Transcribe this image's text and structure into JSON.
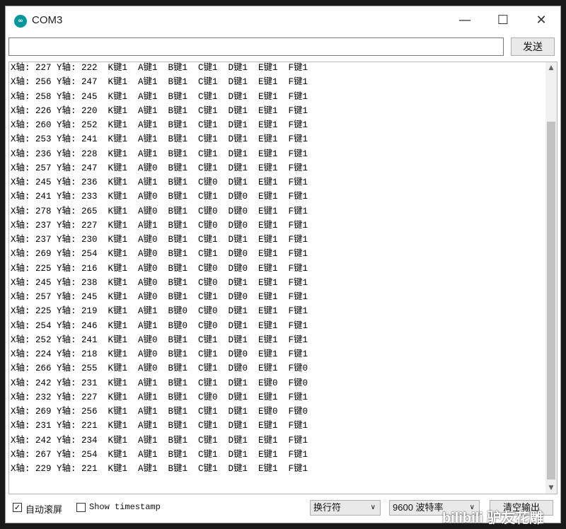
{
  "window": {
    "title": "COM3",
    "icon": "arduino-icon",
    "controls": {
      "minimize": "—",
      "maximize": "☐",
      "close": "✕"
    }
  },
  "send_bar": {
    "input_value": "",
    "send_label": "发送"
  },
  "output_lines": [
    "X轴: 227 Y轴: 222  K键1  A键1  B键1  C键1  D键1  E键1  F键1",
    "X轴: 256 Y轴: 247  K键1  A键1  B键1  C键1  D键1  E键1  F键1",
    "X轴: 258 Y轴: 245  K键1  A键1  B键1  C键1  D键1  E键1  F键1",
    "X轴: 226 Y轴: 220  K键1  A键1  B键1  C键1  D键1  E键1  F键1",
    "X轴: 260 Y轴: 252  K键1  A键1  B键1  C键1  D键1  E键1  F键1",
    "X轴: 253 Y轴: 241  K键1  A键1  B键1  C键1  D键1  E键1  F键1",
    "X轴: 236 Y轴: 228  K键1  A键1  B键1  C键1  D键1  E键1  F键1",
    "X轴: 257 Y轴: 247  K键1  A键0  B键1  C键1  D键1  E键1  F键1",
    "X轴: 245 Y轴: 236  K键1  A键1  B键1  C键0  D键1  E键1  F键1",
    "X轴: 241 Y轴: 233  K键1  A键0  B键1  C键1  D键0  E键1  F键1",
    "X轴: 278 Y轴: 265  K键1  A键0  B键1  C键0  D键0  E键1  F键1",
    "X轴: 237 Y轴: 227  K键1  A键1  B键1  C键0  D键0  E键1  F键1",
    "X轴: 237 Y轴: 230  K键1  A键0  B键1  C键1  D键1  E键1  F键1",
    "X轴: 269 Y轴: 254  K键1  A键0  B键1  C键1  D键0  E键1  F键1",
    "X轴: 225 Y轴: 216  K键1  A键0  B键1  C键0  D键0  E键1  F键1",
    "X轴: 245 Y轴: 238  K键1  A键0  B键1  C键0  D键1  E键1  F键1",
    "X轴: 257 Y轴: 245  K键1  A键0  B键1  C键1  D键0  E键1  F键1",
    "X轴: 225 Y轴: 219  K键1  A键1  B键0  C键0  D键1  E键1  F键1",
    "X轴: 254 Y轴: 246  K键1  A键1  B键0  C键0  D键1  E键1  F键1",
    "X轴: 252 Y轴: 241  K键1  A键0  B键1  C键1  D键1  E键1  F键1",
    "X轴: 224 Y轴: 218  K键1  A键0  B键1  C键1  D键0  E键1  F键1",
    "X轴: 266 Y轴: 255  K键1  A键0  B键1  C键1  D键0  E键1  F键0",
    "X轴: 242 Y轴: 231  K键1  A键1  B键1  C键1  D键1  E键0  F键0",
    "X轴: 232 Y轴: 227  K键1  A键1  B键1  C键0  D键1  E键1  F键1",
    "X轴: 269 Y轴: 256  K键1  A键1  B键1  C键1  D键1  E键0  F键0",
    "X轴: 231 Y轴: 221  K键1  A键1  B键1  C键1  D键1  E键1  F键1",
    "X轴: 242 Y轴: 234  K键1  A键1  B键1  C键1  D键1  E键1  F键1",
    "X轴: 267 Y轴: 254  K键1  A键1  B键1  C键1  D键1  E键1  F键1",
    "X轴: 229 Y轴: 221  K键1  A键1  B键1  C键1  D键1  E键1  F键1"
  ],
  "bottom_bar": {
    "autoscroll": {
      "label": "自动滚屏",
      "checked": true,
      "mark": "✓"
    },
    "timestamp": {
      "label": "Show timestamp",
      "checked": false
    },
    "line_ending": {
      "selected": "换行符",
      "arrow": "∨"
    },
    "baud_rate": {
      "selected": "9600 波特率",
      "arrow": "∨"
    },
    "clear_label": "清空输出"
  },
  "watermark": "bilibili 驴友花雕"
}
